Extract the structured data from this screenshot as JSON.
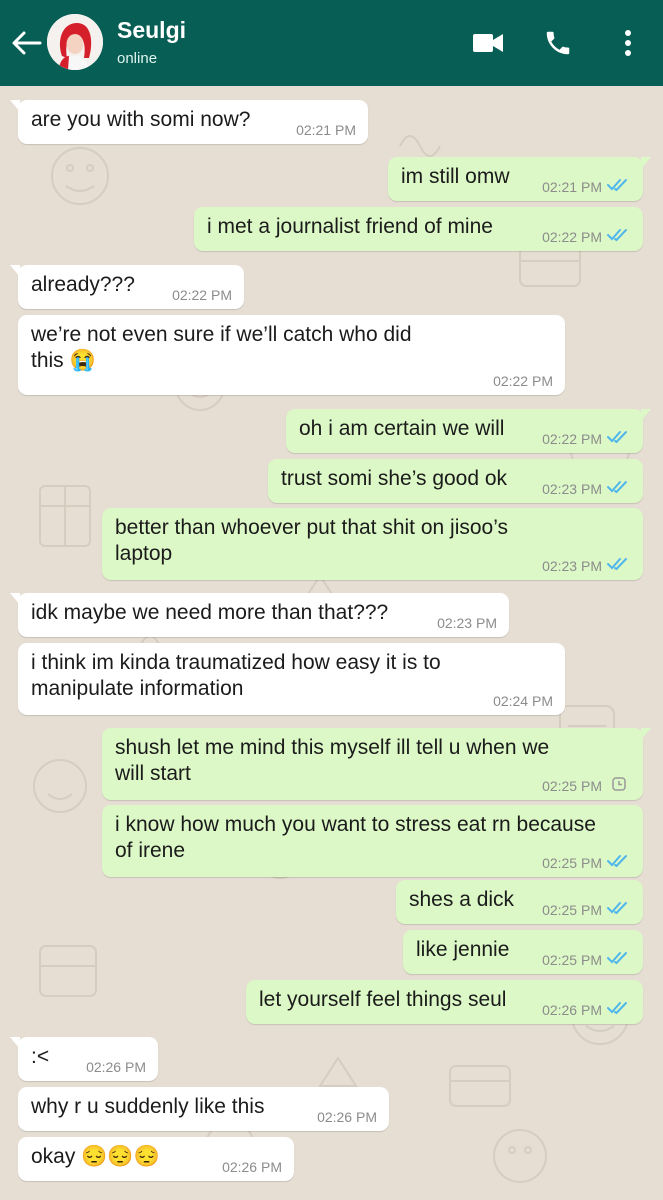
{
  "header": {
    "name": "Seulgi",
    "status": "online",
    "icons": [
      "back-arrow-icon",
      "video-call-icon",
      "phone-icon",
      "more-vertical-icon"
    ]
  },
  "colors": {
    "header_bg": "#075e54",
    "incoming_bubble": "#ffffff",
    "outgoing_bubble": "#dcf8c6",
    "read_ticks": "#4fb6ec",
    "chat_bg": "#e6ded3"
  },
  "messages": [
    {
      "dir": "in",
      "text": "are you with somi now?",
      "time": "02:21 PM"
    },
    {
      "dir": "out",
      "text": "im still omw",
      "time": "02:21 PM",
      "status": "read"
    },
    {
      "dir": "out",
      "text": "i met a journalist friend of mine",
      "time": "02:22 PM",
      "status": "read"
    },
    {
      "dir": "in",
      "text": "already???",
      "time": "02:22 PM"
    },
    {
      "dir": "in",
      "text": "we’re not even sure if we’ll catch who did\nthis 😭",
      "time": "02:22 PM"
    },
    {
      "dir": "out",
      "text": "oh i am certain we will",
      "time": "02:22 PM",
      "status": "read"
    },
    {
      "dir": "out",
      "text": "trust somi she’s good ok",
      "time": "02:23 PM",
      "status": "read"
    },
    {
      "dir": "out",
      "text": "better than whoever put that shit on jisoo’s\nlaptop",
      "time": "02:23 PM",
      "status": "read"
    },
    {
      "dir": "in",
      "text": "idk maybe we need more than that???",
      "time": "02:23 PM"
    },
    {
      "dir": "in",
      "text": "i think im kinda traumatized how easy it is to\nmanipulate information",
      "time": "02:24 PM"
    },
    {
      "dir": "out",
      "text": "shush let me mind this myself ill tell u when we\nwill start",
      "time": "02:25 PM",
      "status": "pending"
    },
    {
      "dir": "out",
      "text": "i know how much you want to stress eat rn because\nof irene",
      "time": "02:25 PM",
      "status": "read"
    },
    {
      "dir": "out",
      "text": "shes a dick",
      "time": "02:25 PM",
      "status": "read"
    },
    {
      "dir": "out",
      "text": "like jennie",
      "time": "02:25 PM",
      "status": "read"
    },
    {
      "dir": "out",
      "text": "let yourself feel things seul",
      "time": "02:26 PM",
      "status": "read"
    },
    {
      "dir": "in",
      "text": ":<",
      "time": "02:26 PM"
    },
    {
      "dir": "in",
      "text": "why r u suddenly like this",
      "time": "02:26 PM"
    },
    {
      "dir": "in",
      "text": "okay 😔😔😔",
      "time": "02:26 PM"
    }
  ]
}
